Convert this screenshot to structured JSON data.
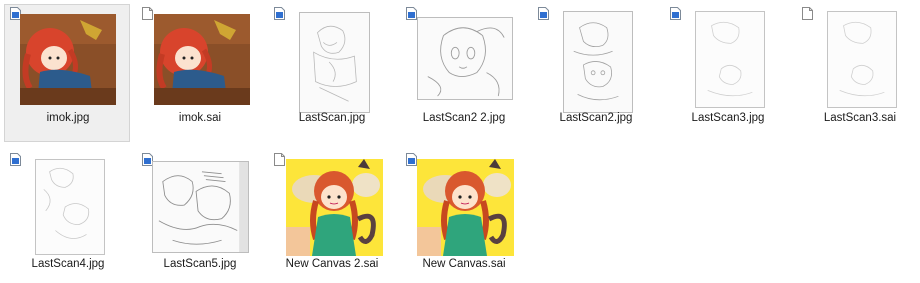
{
  "window": {
    "view": "large-icons"
  },
  "files": [
    {
      "name": "imok.jpg",
      "thumbnail": "colored-girl-at-desk",
      "badge_icon": "image-file-icon"
    },
    {
      "name": "imok.sai",
      "thumbnail": "colored-girl-at-desk",
      "badge_icon": "blank-file-icon"
    },
    {
      "name": "LastScan.jpg",
      "thumbnail": "pencil-sketch",
      "badge_icon": "image-file-icon"
    },
    {
      "name": "LastScan2 2.jpg",
      "thumbnail": "pencil-sketch-face",
      "badge_icon": "image-file-icon"
    },
    {
      "name": "LastScan2.jpg",
      "thumbnail": "pencil-sketch-portrait",
      "badge_icon": "image-file-icon"
    },
    {
      "name": "LastScan3.jpg",
      "thumbnail": "faint-sketch",
      "badge_icon": "image-file-icon"
    },
    {
      "name": "LastScan3.sai",
      "thumbnail": "faint-sketch",
      "badge_icon": "blank-file-icon"
    },
    {
      "name": "LastScan4.jpg",
      "thumbnail": "faint-sketch-portrait",
      "badge_icon": "image-file-icon"
    },
    {
      "name": "LastScan5.jpg",
      "thumbnail": "pencil-sketch-landscape",
      "badge_icon": "image-file-icon"
    },
    {
      "name": "New Canvas 2.sai",
      "thumbnail": "colored-catgirl",
      "badge_icon": "blank-file-icon"
    },
    {
      "name": "New Canvas.sai",
      "thumbnail": "colored-catgirl",
      "badge_icon": "image-file-icon"
    }
  ],
  "selected_index": 0,
  "colors": {
    "selection_bg": "#efefef",
    "selection_border": "#d4d4d4",
    "badge_blue": "#2f6fd0"
  }
}
